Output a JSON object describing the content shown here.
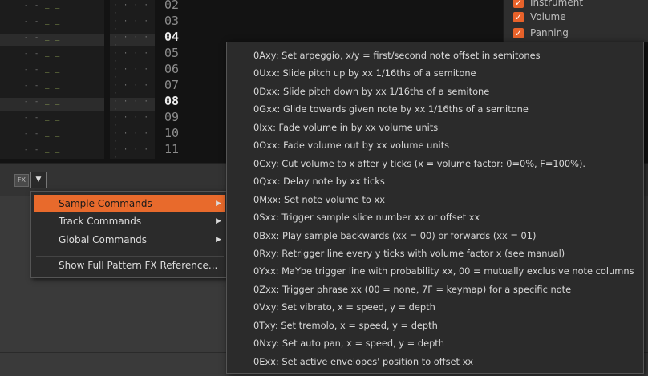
{
  "lines": {
    "numbers": [
      "02",
      "03",
      "04",
      "05",
      "06",
      "07",
      "08",
      "09",
      "10",
      "11"
    ],
    "highlighted": [
      "04",
      "08"
    ]
  },
  "track_glyphs": {
    "note": "- -",
    "green": "_ _",
    "col2": "· · · · ·"
  },
  "effect_columns": {
    "options": [
      {
        "label": "Instrument",
        "checked": true
      },
      {
        "label": "Volume",
        "checked": true
      },
      {
        "label": "Panning",
        "checked": true
      }
    ]
  },
  "toolbar": {
    "fx_label": "FX",
    "dropdown_glyph": "▼"
  },
  "fx_menu": {
    "items": [
      {
        "label": "Sample Commands",
        "has_submenu": true
      },
      {
        "label": "Track Commands",
        "has_submenu": true
      },
      {
        "label": "Global Commands",
        "has_submenu": true
      },
      {
        "label": "Show Full Pattern FX Reference...",
        "has_submenu": false
      }
    ],
    "submenu_arrow": "▶"
  },
  "sample_commands": [
    "0Axy: Set arpeggio, x/y = first/second note offset in semitones",
    "0Uxx: Slide pitch up by xx 1/16ths of a semitone",
    "0Dxx: Slide pitch down by xx 1/16ths of a semitone",
    "0Gxx: Glide towards given note by xx 1/16ths of a semitone",
    "0Ixx: Fade volume in by xx volume units",
    "0Oxx: Fade volume out by xx volume units",
    "0Cxy: Cut volume to x after y ticks (x = volume factor: 0=0%, F=100%).",
    "0Qxx: Delay note by xx ticks",
    "0Mxx: Set note volume to xx",
    "0Sxx: Trigger sample slice number xx or offset xx",
    "0Bxx: Play sample backwards (xx = 00) or forwards (xx = 01)",
    "0Rxy: Retrigger line every y ticks with volume factor x (see manual)",
    "0Yxx: MaYbe trigger line with probability xx, 00 = mutually exclusive note columns",
    "0Zxx: Trigger phrase xx (00 = none, 7F = keymap) for a specific note",
    "0Vxy: Set vibrato, x = speed, y = depth",
    "0Txy: Set tremolo, x = speed, y = depth",
    "0Nxy: Set auto pan, x = speed, y = depth",
    "0Exx: Set active envelopes' position to offset xx"
  ],
  "colors": {
    "accent": "#e86a2c",
    "menu_bg": "#2b2b2b",
    "pattern_bg": "#131313"
  }
}
